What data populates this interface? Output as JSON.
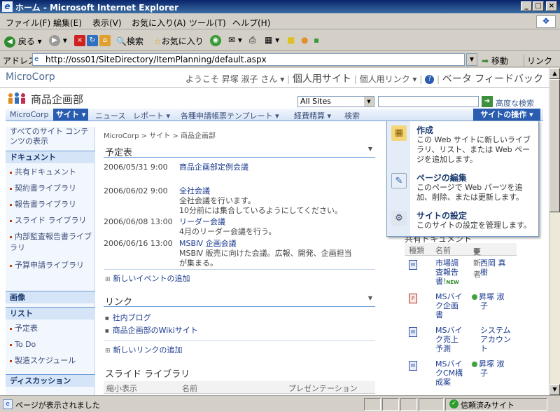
{
  "window": {
    "title": "ホーム - Microsoft Internet Explorer"
  },
  "menu": [
    "ファイル(F)",
    "編集(E)",
    "表示(V)",
    "お気に入り(A)",
    "ツール(T)",
    "ヘルプ(H)"
  ],
  "toolbar": {
    "back": "戻る",
    "search": "検索",
    "favorites": "お気に入り"
  },
  "address": {
    "label": "アドレス(D)",
    "url": "http://oss01/SiteDirectory/ItemPlanning/default.aspx",
    "go": "移動",
    "links": "リンク"
  },
  "sp": {
    "brand": "MicroCorp",
    "welcome": "ようこそ 昇塚 淑子 さん",
    "mysite": "個人用サイト",
    "mylinks": "個人用リンク",
    "feedback": "ベータ フィードバック",
    "site_title": "商品企画部",
    "scope": "All Sites",
    "advanced_search": "高度な検索"
  },
  "nav": {
    "items": [
      "MicroCorp",
      "サイト",
      "ニュース",
      "レポート",
      "各種申請帳票テンプレート",
      "経費精算",
      "検索"
    ],
    "site_actions": "サイトの操作"
  },
  "quicklaunch": {
    "view_all": "すべてのサイト コンテンツの表示",
    "h_docs": "ドキュメント",
    "docs": [
      "共有ドキュメント",
      "契約書ライブラリ",
      "報告書ライブラリ",
      "スライド ライブラリ",
      "内部監査報告書ライブラリ",
      "予算申請ライブラリ"
    ],
    "h_images": "画像",
    "h_lists": "リスト",
    "lists": [
      "予定表",
      "To Do",
      "製造スケジュール"
    ],
    "h_discussion": "ディスカッション"
  },
  "breadcrumb": "MicroCorp > サイト > 商品企画部",
  "calendar": {
    "title": "予定表",
    "events": [
      {
        "date": "2006/05/31 9:00",
        "title": "商品企画部定例会議",
        "desc": []
      },
      {
        "date": "2006/06/02 9:00",
        "title": "全社会議",
        "desc": [
          "全社会議を行います。",
          "10分前には集合しているようにしてください。"
        ]
      },
      {
        "date": "2006/06/08 13:00",
        "title": "リーダー会議",
        "desc": [
          "4月のリーダー会議を行う。"
        ]
      },
      {
        "date": "2006/06/16 13:00",
        "title": "MSBⅣ 企画会議",
        "desc": [
          "MSBⅣ 販売に向けた会議。広報、開発、企画担当",
          "が集まる。"
        ]
      }
    ],
    "add": "新しいイベントの追加"
  },
  "links": {
    "title": "リンク",
    "items": [
      "社内ブログ",
      "商品企画部のWikiサイト"
    ],
    "add": "新しいリンクの追加"
  },
  "slides": {
    "title": "スライド ライブラリ",
    "cols": [
      "縮小表示",
      "名前",
      "プレゼンテーション"
    ]
  },
  "docs": {
    "title": "共有ドキュメント",
    "cols": [
      "種類",
      "名前",
      "更新者"
    ],
    "rows": [
      {
        "type": "doc",
        "name": [
          "市場調",
          "査報告",
          "書"
        ],
        "new": "NEW",
        "user": [
          "西岡 真",
          "樹"
        ]
      },
      {
        "type": "ppt",
        "name": [
          "MSバイ",
          "ク企画",
          "書"
        ],
        "new": "",
        "user": [
          "昇塚 淑",
          "子"
        ]
      },
      {
        "type": "doc",
        "name": [
          "MSバイ",
          "ク売上",
          "予測"
        ],
        "new": "",
        "user": [
          "システム",
          "アカウン",
          "ト"
        ]
      },
      {
        "type": "doc",
        "name": [
          "MSバイ",
          "クCM構",
          "成案"
        ],
        "new": "",
        "user": [
          "昇塚 淑",
          "子"
        ]
      }
    ]
  },
  "site_actions_menu": [
    {
      "title": "作成",
      "desc": "この Web サイトに新しいライブラリ、リスト、または Web ページを追加します。",
      "icon": "create-icon"
    },
    {
      "title": "ページの編集",
      "desc": "このページで Web パーツを追加、削除、または更新します。",
      "icon": "edit-page-icon"
    },
    {
      "title": "サイトの設定",
      "desc": "このサイトの設定を管理します。",
      "icon": "settings-icon"
    }
  ],
  "status": {
    "text": "ページが表示されました",
    "zone": "信頼済みサイト"
  }
}
